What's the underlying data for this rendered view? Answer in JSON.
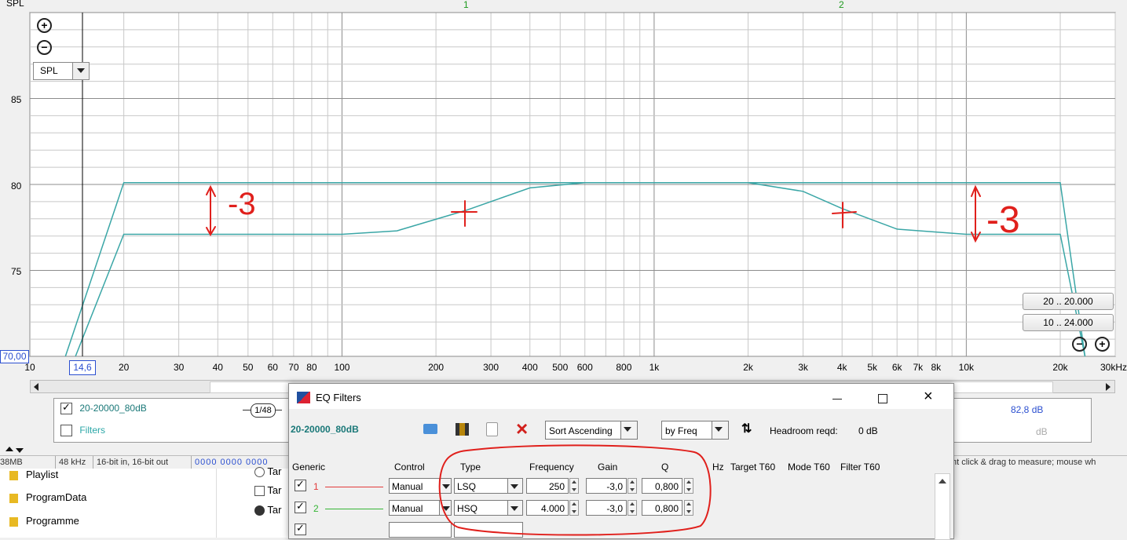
{
  "graph": {
    "y_axis_title": "SPL",
    "filter_markers": [
      "1",
      "2"
    ],
    "measurement_selector": "SPL",
    "y_ticks": [
      "85",
      "80",
      "75"
    ],
    "y_min_value": "70,00",
    "x_ticks": [
      "10",
      "20",
      "30",
      "40",
      "50",
      "60",
      "70",
      "80",
      "100",
      "200",
      "300",
      "400",
      "500",
      "600",
      "800",
      "1k",
      "2k",
      "3k",
      "4k",
      "5k",
      "6k",
      "7k",
      "8k",
      "10k",
      "20k",
      "30kHz"
    ],
    "cursor_value": "14,6",
    "range_buttons": [
      "20 .. 20.000",
      "10 .. 24.000"
    ],
    "annotations": [
      "-3",
      "-3"
    ],
    "colors": {
      "target_curve": "#3aa6a6",
      "eq_curve": "#3aa6a6",
      "annotation": "#e0201c",
      "grid_major": "#8c8c8c",
      "grid_minor": "#c8c8c8"
    }
  },
  "chart_data": {
    "type": "line",
    "xlabel": "",
    "ylabel": "SPL",
    "x_scale": "log",
    "xlim": [
      10,
      30000
    ],
    "ylim": [
      70,
      90
    ],
    "series": [
      {
        "x": [
          13,
          20,
          20000,
          24000
        ],
        "y": [
          70,
          80.1,
          80.1,
          70
        ]
      },
      {
        "x": [
          14,
          20,
          100,
          150,
          250,
          400,
          600,
          1000,
          2000,
          3000,
          4000,
          6000,
          10000,
          20000,
          24000
        ],
        "y": [
          70,
          77.1,
          77.1,
          77.3,
          78.5,
          79.8,
          80.1,
          80.1,
          80.1,
          79.6,
          78.6,
          77.4,
          77.1,
          77.1,
          70
        ]
      }
    ]
  },
  "legend": {
    "items": [
      {
        "label": "20-20000_80dB",
        "checked": true
      },
      {
        "label": "Filters",
        "checked": false
      }
    ],
    "smoothing": "1/48",
    "values": [
      "82,8 dB",
      "dB"
    ]
  },
  "status_bar": {
    "memory": "38MB",
    "sample_rate": "48 kHz",
    "bit_depth": "16-bit in, 16-bit out",
    "digits": "0000 0000  0000",
    "hint": "ht click & drag to measure; mouse wh"
  },
  "eq_window": {
    "title": "EQ Filters",
    "measurement_name": "20-20000_80dB",
    "sort_select": "Sort Ascending",
    "sort_by": "by Freq",
    "headroom_label": "Headroom reqd:",
    "headroom_value": "0 dB",
    "columns": [
      "Generic",
      "Control",
      "Type",
      "Frequency",
      "Gain",
      "Q",
      "Hz",
      "Target T60",
      "Mode T60",
      "Filter T60"
    ],
    "filters": [
      {
        "index": "1",
        "control": "Manual",
        "type": "LSQ",
        "frequency": "250",
        "gain": "-3,0",
        "q": "0,800",
        "line_color": "#e23b3b"
      },
      {
        "index": "2",
        "control": "Manual",
        "type": "HSQ",
        "frequency": "4.000",
        "gain": "-3,0",
        "q": "0,800",
        "line_color": "#35b535"
      }
    ]
  },
  "explorer": {
    "folders": [
      "Playlist",
      "ProgramData",
      "Programme"
    ],
    "files": [
      "Tar",
      "Tar",
      "Tar"
    ]
  }
}
